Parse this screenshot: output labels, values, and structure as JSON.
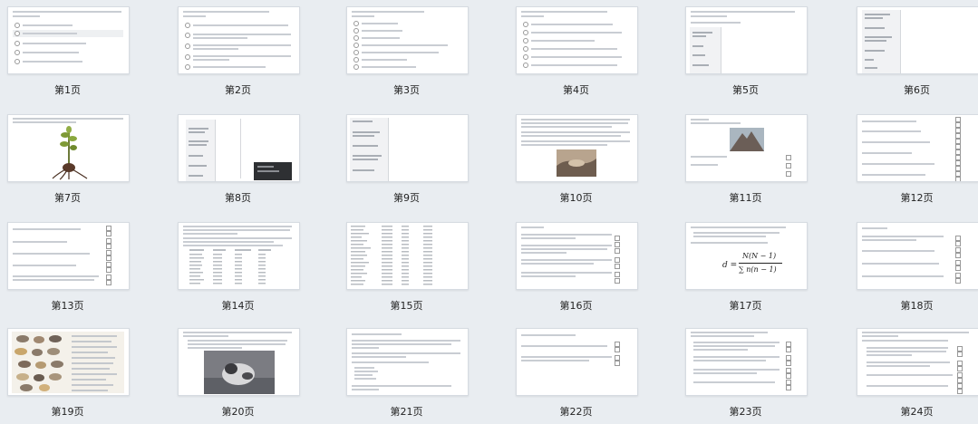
{
  "pages": [
    {
      "label": "第1页"
    },
    {
      "label": "第2页"
    },
    {
      "label": "第3页"
    },
    {
      "label": "第4页"
    },
    {
      "label": "第5页"
    },
    {
      "label": "第6页"
    },
    {
      "label": "第7页"
    },
    {
      "label": "第8页"
    },
    {
      "label": "第9页"
    },
    {
      "label": "第10页"
    },
    {
      "label": "第11页"
    },
    {
      "label": "第12页"
    },
    {
      "label": "第13页"
    },
    {
      "label": "第14页"
    },
    {
      "label": "第15页"
    },
    {
      "label": "第16页"
    },
    {
      "label": "第17页"
    },
    {
      "label": "第18页"
    },
    {
      "label": "第19页"
    },
    {
      "label": "第20页"
    },
    {
      "label": "第21页"
    },
    {
      "label": "第22页"
    },
    {
      "label": "第23页"
    },
    {
      "label": "第24页"
    }
  ],
  "formula": {
    "lhs": "d =",
    "numerator": "N(N − 1)",
    "denominator": "∑ n(n − 1)"
  }
}
